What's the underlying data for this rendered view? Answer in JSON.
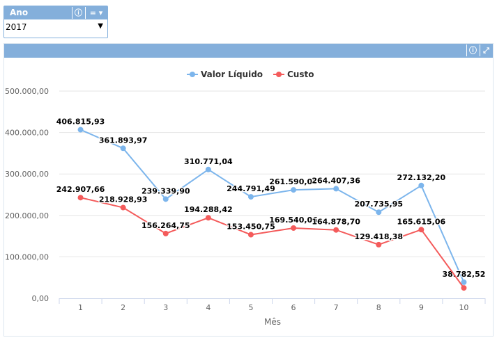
{
  "filter": {
    "title": "Ano",
    "selected": "2017",
    "info_icon": "info-icon",
    "menu_label": "= ▾",
    "arrow": "▼"
  },
  "panel": {
    "info_icon": "info-icon",
    "expand_icon": "expand-icon"
  },
  "chart_data": {
    "type": "line",
    "categories": [
      "1",
      "2",
      "3",
      "4",
      "5",
      "6",
      "7",
      "8",
      "9",
      "10"
    ],
    "xlabel": "Mês",
    "ylabel": "",
    "ylim": [
      0,
      500000
    ],
    "yticks": [
      "0,00",
      "100.000,00",
      "200.000,00",
      "300.000,00",
      "400.000,00",
      "500.000,00"
    ],
    "grid": true,
    "legend": "top-center",
    "series": [
      {
        "name": "Valor Líquido",
        "color": "#7cb5ec",
        "values": [
          406815.93,
          361893.97,
          239339.9,
          310771.04,
          244791.49,
          261590.08,
          264407.36,
          207735.95,
          272132.2,
          38782.52
        ],
        "labels": [
          "406.815,93",
          "361.893,97",
          "239.339,90",
          "310.771,04",
          "244.791,49",
          "261.590,08",
          "264.407,36",
          "207.735,95",
          "272.132,20",
          "38.782,52"
        ]
      },
      {
        "name": "Custo",
        "color": "#f45b5b",
        "values": [
          242907.66,
          218928.93,
          156264.75,
          194288.42,
          153450.75,
          169540.06,
          164878.7,
          129418.38,
          165615.06,
          25000
        ],
        "labels": [
          "242.907,66",
          "218.928,93",
          "156.264,75",
          "194.288,42",
          "153.450,75",
          "169.540,06",
          "164.878,70",
          "129.418,38",
          "165.615,06",
          ""
        ]
      }
    ]
  }
}
